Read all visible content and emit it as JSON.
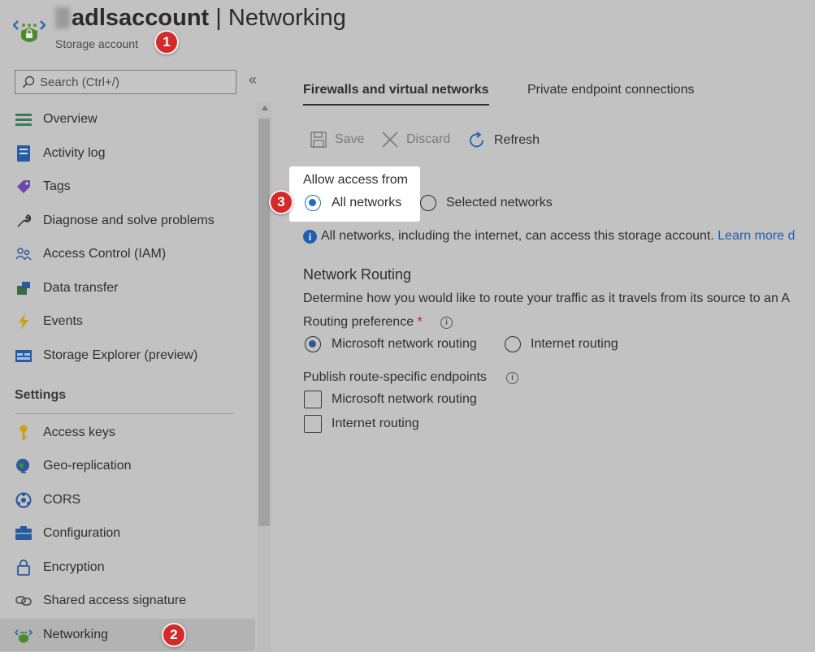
{
  "header": {
    "title_name": "adlsaccount",
    "title_separator": " | ",
    "title_page": "Networking",
    "subtitle": "Storage account"
  },
  "badges": {
    "one": "1",
    "two": "2",
    "three": "3"
  },
  "sidebar": {
    "search_placeholder": "Search (Ctrl+/)",
    "collapse_glyph": "«",
    "items": [
      {
        "label": "Overview",
        "icon": "overview-icon"
      },
      {
        "label": "Activity log",
        "icon": "activity-log-icon"
      },
      {
        "label": "Tags",
        "icon": "tag-icon"
      },
      {
        "label": "Diagnose and solve problems",
        "icon": "wrench-icon"
      },
      {
        "label": "Access Control (IAM)",
        "icon": "people-icon"
      },
      {
        "label": "Data transfer",
        "icon": "data-transfer-icon"
      },
      {
        "label": "Events",
        "icon": "lightning-icon"
      },
      {
        "label": "Storage Explorer (preview)",
        "icon": "storage-explorer-icon"
      }
    ],
    "settings_label": "Settings",
    "settings_items": [
      {
        "label": "Access keys",
        "icon": "key-icon"
      },
      {
        "label": "Geo-replication",
        "icon": "globe-icon"
      },
      {
        "label": "CORS",
        "icon": "cors-icon"
      },
      {
        "label": "Configuration",
        "icon": "configuration-icon"
      },
      {
        "label": "Encryption",
        "icon": "lock-icon"
      },
      {
        "label": "Shared access signature",
        "icon": "link-icon"
      },
      {
        "label": "Networking",
        "icon": "networking-icon"
      }
    ]
  },
  "tabs": [
    {
      "label": "Firewalls and virtual networks",
      "active": true
    },
    {
      "label": "Private endpoint connections",
      "active": false
    }
  ],
  "toolbar": {
    "save": "Save",
    "discard": "Discard",
    "refresh": "Refresh"
  },
  "access": {
    "label": "Allow access from",
    "option_all": "All networks",
    "option_selected": "Selected networks",
    "selected_value": "All networks",
    "info_text": "All networks, including the internet, can access this storage account.",
    "learn_more": "Learn more d"
  },
  "routing": {
    "heading": "Network Routing",
    "description": "Determine how you would like to route your traffic as it travels from its source to an A",
    "preference_label": "Routing preference",
    "required_mark": "*",
    "option_microsoft": "Microsoft network routing",
    "option_internet": "Internet routing",
    "selected_value": "Microsoft network routing",
    "publish_label": "Publish route-specific endpoints",
    "publish_microsoft": "Microsoft network routing",
    "publish_internet": "Internet routing",
    "info_glyph": "i"
  },
  "colors": {
    "accent": "#1f6fc4",
    "badge": "#d42a2a",
    "overlay_bg": "#c2c2c2"
  }
}
